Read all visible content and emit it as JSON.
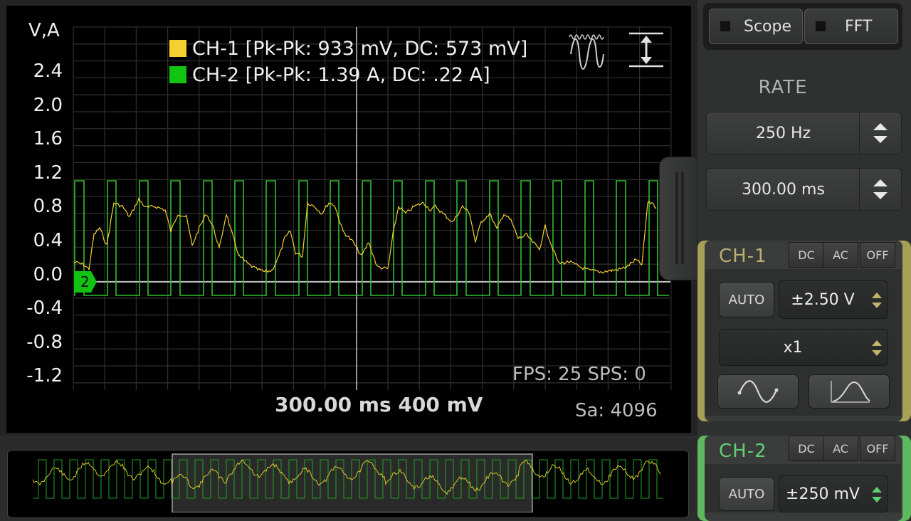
{
  "scope": {
    "yaxis_unit": "V,A",
    "y_ticks": [
      "2.4",
      "2.0",
      "1.6",
      "1.2",
      "0.8",
      "0.4",
      "0.0",
      "-0.4",
      "-0.8",
      "-1.2"
    ],
    "legend": [
      {
        "label": "CH-1 [Pk-Pk: 933 mV, DC: 573 mV]",
        "color": "#f3d230"
      },
      {
        "label": "CH-2 [Pk-Pk: 1.39 A, DC: .22 A]",
        "color": "#1ec81e"
      }
    ],
    "stats": "FPS: 25  SPS: 0",
    "timebase": "300.00 ms  400 mV",
    "samples": "Sa: 4096",
    "marker_label": "2",
    "ch1_color": "#f3d230",
    "ch2_color": "#2fbf2f"
  },
  "mode": {
    "scope_label": "Scope",
    "fft_label": "FFT"
  },
  "rate": {
    "title": "RATE",
    "rate_value": "250 Hz",
    "window_value": "300.00 ms"
  },
  "ch1": {
    "title": "CH-1",
    "accent": "#a8a058",
    "coupling": [
      "DC",
      "AC",
      "OFF"
    ],
    "auto_label": "AUTO",
    "range_value": "±2.50 V",
    "probe_value": "x1"
  },
  "ch2": {
    "title": "CH-2",
    "accent": "#5fb85f",
    "coupling": [
      "DC",
      "AC",
      "OFF"
    ],
    "auto_label": "AUTO",
    "range_value": "±250 mV"
  }
}
